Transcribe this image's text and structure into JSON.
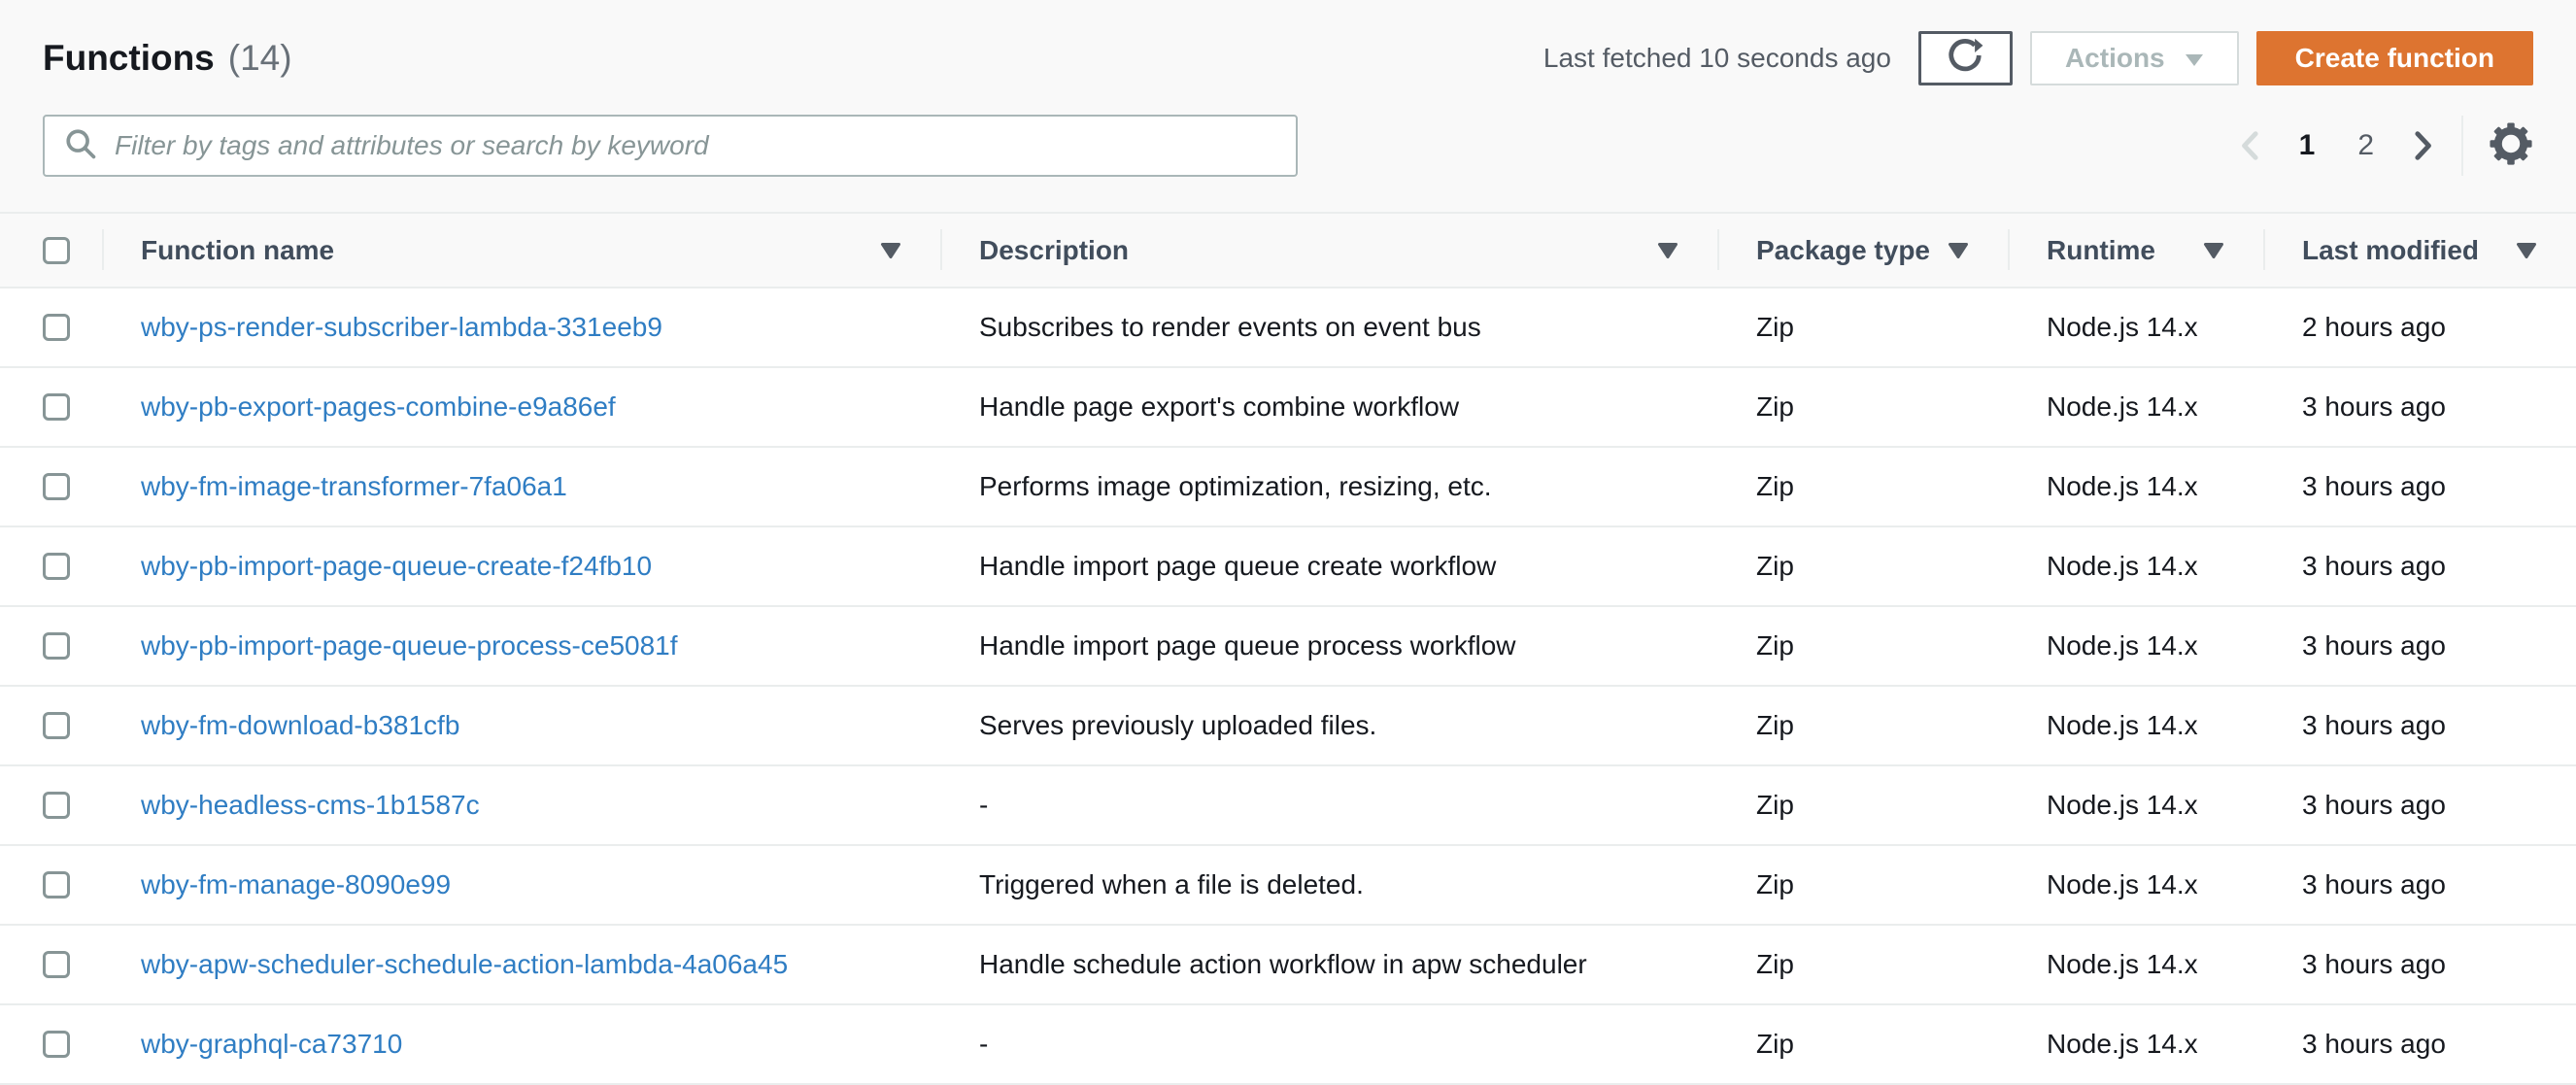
{
  "header": {
    "title": "Functions",
    "count": "(14)",
    "last_fetched": "Last fetched 10 seconds ago",
    "actions_label": "Actions",
    "create_label": "Create function"
  },
  "search": {
    "placeholder": "Filter by tags and attributes or search by keyword",
    "value": ""
  },
  "pagination": {
    "current_page": "1",
    "next_page": "2"
  },
  "table": {
    "columns": [
      "Function name",
      "Description",
      "Package type",
      "Runtime",
      "Last modified"
    ],
    "rows": [
      {
        "name": "wby-ps-render-subscriber-lambda-331eeb9",
        "description": "Subscribes to render events on event bus",
        "package_type": "Zip",
        "runtime": "Node.js 14.x",
        "last_modified": "2 hours ago"
      },
      {
        "name": "wby-pb-export-pages-combine-e9a86ef",
        "description": "Handle page export's combine workflow",
        "package_type": "Zip",
        "runtime": "Node.js 14.x",
        "last_modified": "3 hours ago"
      },
      {
        "name": "wby-fm-image-transformer-7fa06a1",
        "description": "Performs image optimization, resizing, etc.",
        "package_type": "Zip",
        "runtime": "Node.js 14.x",
        "last_modified": "3 hours ago"
      },
      {
        "name": "wby-pb-import-page-queue-create-f24fb10",
        "description": "Handle import page queue create workflow",
        "package_type": "Zip",
        "runtime": "Node.js 14.x",
        "last_modified": "3 hours ago"
      },
      {
        "name": "wby-pb-import-page-queue-process-ce5081f",
        "description": "Handle import page queue process workflow",
        "package_type": "Zip",
        "runtime": "Node.js 14.x",
        "last_modified": "3 hours ago"
      },
      {
        "name": "wby-fm-download-b381cfb",
        "description": "Serves previously uploaded files.",
        "package_type": "Zip",
        "runtime": "Node.js 14.x",
        "last_modified": "3 hours ago"
      },
      {
        "name": "wby-headless-cms-1b1587c",
        "description": "-",
        "package_type": "Zip",
        "runtime": "Node.js 14.x",
        "last_modified": "3 hours ago"
      },
      {
        "name": "wby-fm-manage-8090e99",
        "description": "Triggered when a file is deleted.",
        "package_type": "Zip",
        "runtime": "Node.js 14.x",
        "last_modified": "3 hours ago"
      },
      {
        "name": "wby-apw-scheduler-schedule-action-lambda-4a06a45",
        "description": "Handle schedule action workflow in apw scheduler",
        "package_type": "Zip",
        "runtime": "Node.js 14.x",
        "last_modified": "3 hours ago"
      },
      {
        "name": "wby-graphql-ca73710",
        "description": "-",
        "package_type": "Zip",
        "runtime": "Node.js 14.x",
        "last_modified": "3 hours ago"
      }
    ]
  },
  "colors": {
    "accent_orange": "#dd7430",
    "link_blue": "#2f7dc3",
    "border_gray": "#eaeded"
  },
  "icons": {
    "refresh": "refresh-icon",
    "caret_down": "caret-down-icon",
    "search": "search-icon",
    "prev": "chevron-left-icon",
    "next": "chevron-right-icon",
    "settings": "gear-icon",
    "sort": "sort-arrow-icon"
  }
}
